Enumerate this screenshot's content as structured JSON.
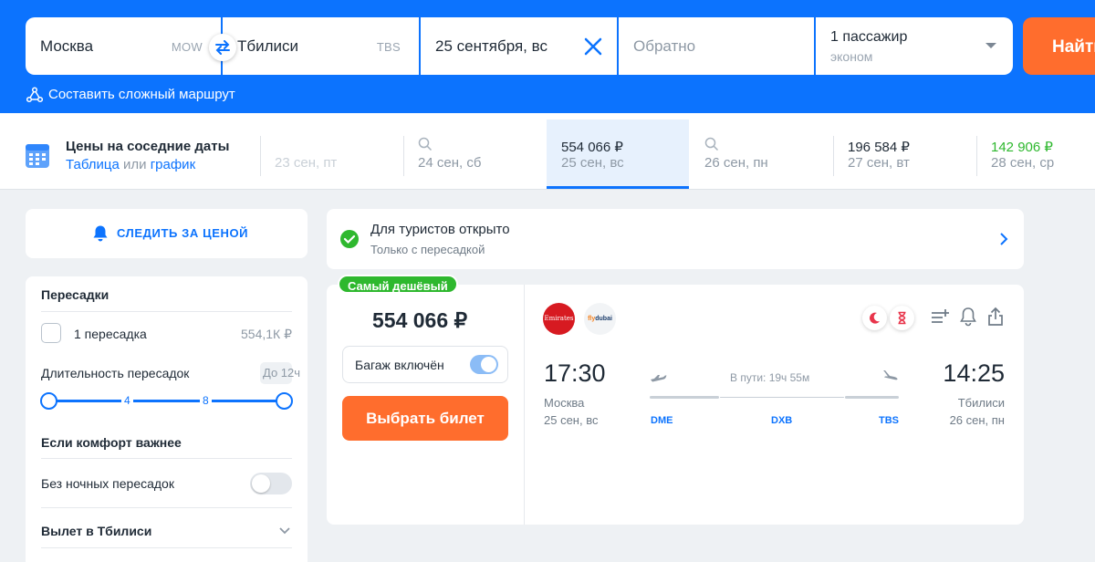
{
  "search": {
    "from_city": "Москва",
    "from_iata": "MOW",
    "to_city": "Тбилиси",
    "to_iata": "TBS",
    "date": "25 сентября, вс",
    "return_placeholder": "Обратно",
    "passengers": "1 пассажир",
    "cabin": "эконом",
    "find_label": "Найти",
    "complex_route_label": "Составить сложный маршрут"
  },
  "dates": {
    "title": "Цены на соседние даты",
    "sub_prefix": "Таблица",
    "sub_mid": " или ",
    "sub_link": "график",
    "days": [
      {
        "price": "",
        "date": "23 сен, пт",
        "state": "disabled"
      },
      {
        "price": "",
        "date": "24 сен, сб",
        "state": "search"
      },
      {
        "price": "554 066 ₽",
        "date": "25 сен, вс",
        "state": "active"
      },
      {
        "price": "",
        "date": "26 сен, пн",
        "state": "search"
      },
      {
        "price": "196 584 ₽",
        "date": "27 сен, вт",
        "state": "normal"
      },
      {
        "price": "142 906 ₽",
        "date": "28 сен, ср",
        "state": "cheapest"
      }
    ]
  },
  "sidebar": {
    "follow_label": "СЛЕДИТЬ ЗА ЦЕНОЙ",
    "stops_title": "Пересадки",
    "stop_option": "1 пересадка",
    "stop_price": "554,1К ₽",
    "duration_label": "Длительность пересадок",
    "duration_value": "До 12ч",
    "tick_4": "4",
    "tick_8": "8",
    "comfort_title": "Если комфорт важнее",
    "no_night_label": "Без ночных пересадок",
    "departure_title": "Вылет в Тбилиси"
  },
  "notice": {
    "title": "Для туристов открыто",
    "subtitle": "Только с пересадкой"
  },
  "ticket": {
    "badge": "Самый дешёвый",
    "price": "554 066 ₽",
    "baggage_label": "Багаж включён",
    "buy_label": "Выбрать билет",
    "airline1": "Emirates",
    "airline2_a": "fly",
    "airline2_b": "dubai",
    "dep_time": "17:30",
    "dep_city": "Москва",
    "dep_date": "25 сен, вс",
    "arr_time": "14:25",
    "arr_city": "Тбилиси",
    "arr_date": "26 сен, пн",
    "duration": "В пути: 19ч 55м",
    "airport_dep": "DME",
    "airport_via": "DXB",
    "airport_arr": "TBS"
  },
  "colors": {
    "brand_blue": "#0c73fe",
    "cta_orange": "#ff6d2d",
    "cheap_green": "#2eb82e"
  }
}
